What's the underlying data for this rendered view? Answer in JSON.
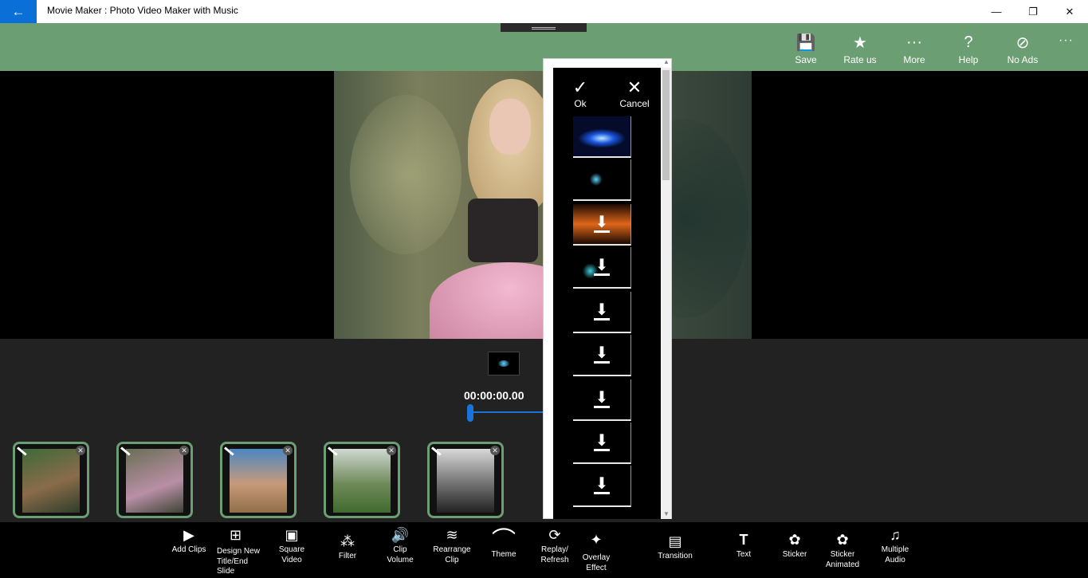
{
  "window": {
    "title": "Movie Maker : Photo Video Maker with Music",
    "back_icon": "←",
    "minimize_icon": "—",
    "maximize_icon": "❐",
    "close_icon": "✕"
  },
  "command_bar": {
    "items": [
      {
        "label": "Save",
        "icon": "💾"
      },
      {
        "label": "Rate us",
        "icon": "★"
      },
      {
        "label": "More",
        "icon": "···"
      },
      {
        "label": "Help",
        "icon": "?"
      },
      {
        "label": "No Ads",
        "icon": "⊘"
      }
    ],
    "overflow_icon": "···"
  },
  "player": {
    "timecode": "00:00:00.00",
    "progress": 0.0
  },
  "clips": [
    {
      "name": "clip-1",
      "delete_icon": "✕"
    },
    {
      "name": "clip-2",
      "delete_icon": "✕"
    },
    {
      "name": "clip-3",
      "delete_icon": "✕"
    },
    {
      "name": "clip-4",
      "delete_icon": "✕"
    },
    {
      "name": "clip-5",
      "delete_icon": "✕"
    }
  ],
  "effect_panel": {
    "ok_label": "Ok",
    "ok_icon": "✓",
    "cancel_label": "Cancel",
    "cancel_icon": "✕",
    "download_icon": "⬇"
  },
  "toolbar": {
    "items": [
      {
        "label": "Add Clips",
        "icon": "▶"
      },
      {
        "label": "Design New\nTitle/End\nSlide",
        "icon": "⊞"
      },
      {
        "label": "Square\nVideo",
        "icon": "▣"
      },
      {
        "label": "Filter",
        "icon": "⁂"
      },
      {
        "label": "Clip\nVolume",
        "icon": "🔊"
      },
      {
        "label": "Rearrange\nClip",
        "icon": "≋"
      },
      {
        "label": "Theme",
        "icon": "⌒"
      },
      {
        "label": "Replay/\nRefresh",
        "icon": "⟳"
      },
      {
        "label": "Overlay\nEffect",
        "icon": "✦"
      },
      {
        "label": "Transition",
        "icon": "▤"
      },
      {
        "label": "Text",
        "icon": "T"
      },
      {
        "label": "Sticker",
        "icon": "✿"
      },
      {
        "label": "Sticker\nAnimated",
        "icon": "✿"
      },
      {
        "label": "Multiple\nAudio",
        "icon": "♫"
      }
    ]
  },
  "colors": {
    "accent": "#6b9e72",
    "titlebar_back": "#0a6fd6",
    "slider": "#1a73d9"
  }
}
